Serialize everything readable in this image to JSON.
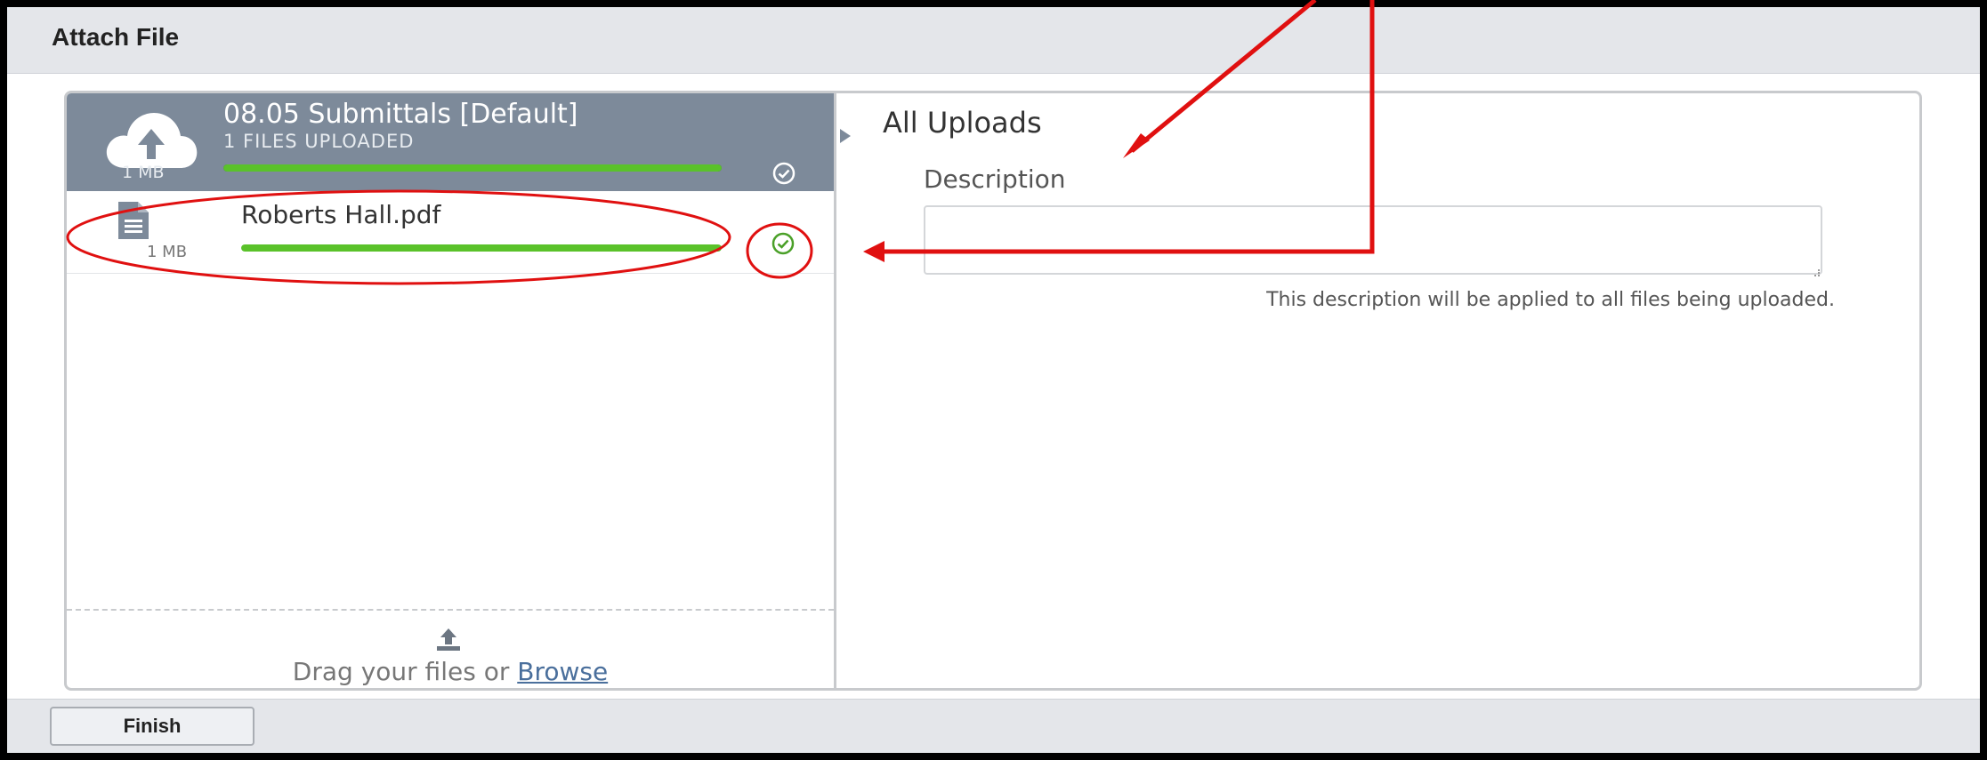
{
  "dialog": {
    "title": "Attach File"
  },
  "group": {
    "name": "08.05 Submittals [Default]",
    "status": "1 FILES UPLOADED",
    "size": "1 MB",
    "progress_percent": 100,
    "icon": "cloud-upload-icon"
  },
  "files": [
    {
      "name": "Roberts Hall.pdf",
      "size": "1 MB",
      "progress_percent": 100,
      "icon": "document-icon",
      "status_icon": "check-circle-icon"
    }
  ],
  "dropzone": {
    "text_prefix": "Drag your files or ",
    "browse_label": "Browse",
    "icon": "upload-icon"
  },
  "details": {
    "heading": "All Uploads",
    "description_label": "Description",
    "description_value": "",
    "description_help": "This description will be applied to all files being uploaded."
  },
  "footer": {
    "finish_label": "Finish"
  },
  "colors": {
    "accent_green": "#5ac22a",
    "header_slate": "#7d8a9a",
    "annotation_red": "#e01010"
  }
}
